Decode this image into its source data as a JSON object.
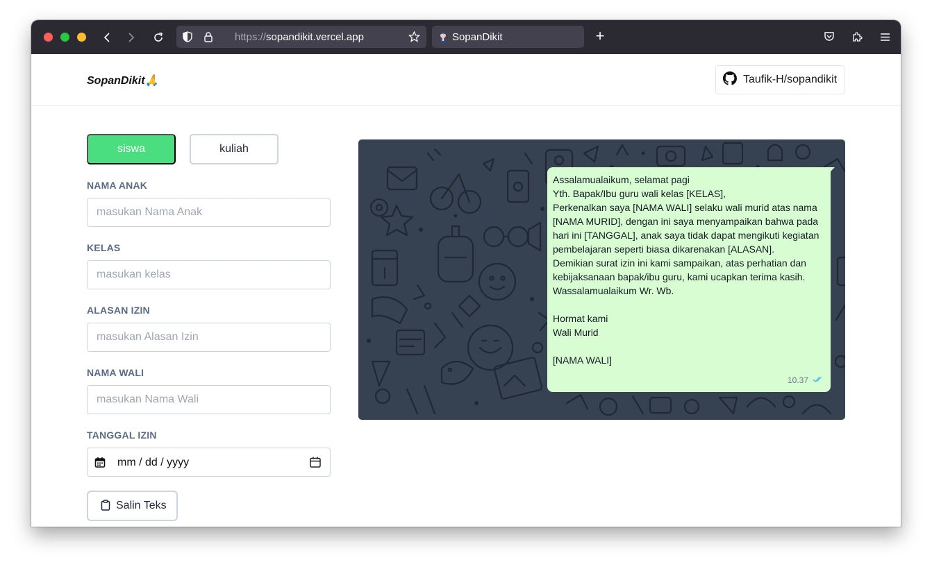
{
  "browser": {
    "url_protocol": "https://",
    "url_host": "sopandikit.vercel.app",
    "tab_title": "SopanDikit",
    "new_tab": "+"
  },
  "header": {
    "brand": "SopanDikit🙏",
    "github_label": "Taufik-H/sopandikit"
  },
  "modes": [
    {
      "label": "siswa",
      "active": true
    },
    {
      "label": "kuliah",
      "active": false
    }
  ],
  "form": {
    "fields": [
      {
        "label": "NAMA ANAK",
        "placeholder": "masukan Nama Anak"
      },
      {
        "label": "KELAS",
        "placeholder": "masukan kelas"
      },
      {
        "label": "ALASAN IZIN",
        "placeholder": "masukan Alasan Izin"
      },
      {
        "label": "NAMA WALI",
        "placeholder": "masukan Nama Wali"
      }
    ],
    "date": {
      "label": "TANGGAL IZIN",
      "value": "mm / dd / yyyy"
    },
    "copy_label": "Salin Teks"
  },
  "preview": {
    "lines": [
      "Assalamualaikum, selamat pagi",
      "Yth. Bapak/Ibu guru wali kelas [KELAS],",
      "Perkenalkan saya [NAMA WALI] selaku wali murid atas nama",
      "[NAMA MURID], dengan ini saya menyampaikan bahwa pada",
      "hari ini [TANGGAL], anak saya tidak dapat mengikuti kegiatan",
      "pembelajaran seperti biasa dikarenakan [ALASAN].",
      "Demikian surat izin ini kami sampaikan, atas perhatian dan",
      "kebijaksanaan bapak/ibu guru, kami ucapkan terima kasih.",
      "Wassalamualaikum Wr. Wb.",
      "",
      "Hormat kami",
      "Wali Murid",
      "",
      "[NAMA WALI]"
    ],
    "time": "10.37",
    "colors": {
      "bubble": "#d9fdd3",
      "background": "#364152",
      "accent": "#4ade80"
    }
  }
}
